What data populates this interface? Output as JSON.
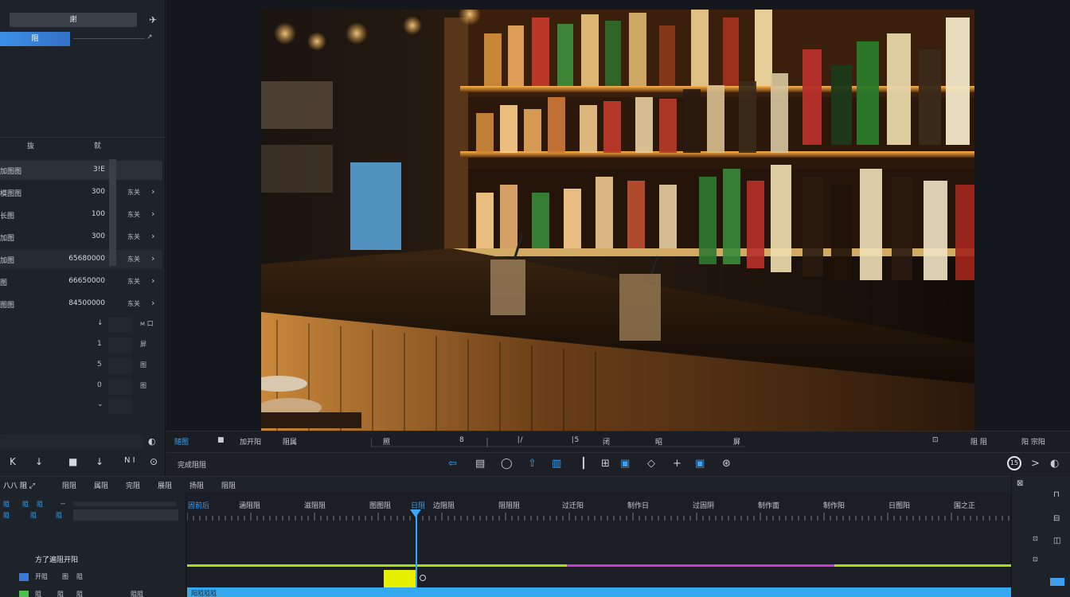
{
  "left_panel": {
    "top_field": "謝",
    "top_icon": "✈",
    "active_tab": "阻",
    "tab_end": "↗",
    "props_header": [
      "抜",
      "就"
    ],
    "properties": [
      {
        "label": "加图图",
        "value": "3!E",
        "action": "",
        "hl": true
      },
      {
        "label": "模图图",
        "value": "300",
        "action": "东关",
        "hl": false
      },
      {
        "label": "长图",
        "value": "100",
        "action": "东关",
        "hl": false
      },
      {
        "label": "加图",
        "value": "300",
        "action": "东关",
        "hl": false
      },
      {
        "label": "加图",
        "value": "65680000",
        "action": "东关",
        "hl": true
      },
      {
        "label": "图",
        "value": "66650000",
        "action": "东关",
        "hl": false
      },
      {
        "label": "图图",
        "value": "84500000",
        "action": "东关",
        "hl": false
      }
    ],
    "controls": [
      {
        "k": "↓",
        "v": "ᴍ 口"
      },
      {
        "k": "1",
        "v": "屏"
      },
      {
        "k": "5",
        "v": "图"
      },
      {
        "k": "0",
        "v": "图"
      },
      {
        "k": "⌄",
        "v": ""
      }
    ],
    "bottom_icon": "◐",
    "tools": [
      "K",
      "↓",
      "■",
      "↓",
      "N I",
      "⊙"
    ]
  },
  "preview_toolbar": {
    "items": [
      "随图",
      "■",
      "加开阳",
      "阻属",
      "照",
      "8",
      "∣∕",
      "∣5",
      "闭",
      "昭",
      "屏"
    ],
    "right_items": [
      "⊡",
      "阻 阻",
      "阳 宗阳"
    ]
  },
  "transport": {
    "label": "完成阻阻",
    "icons": [
      "⇦",
      "▤",
      "◯",
      "⇧",
      "▥",
      "┃",
      "⊞",
      "▣",
      "◇",
      "+",
      "▣",
      "⊛"
    ],
    "circle_label": "15",
    "right_icons": [
      ">",
      "◐"
    ]
  },
  "timeline": {
    "tabs": [
      "八八 阻 ⤢",
      "阻阻",
      "属阻",
      "完阻",
      "展阻",
      "扬阻",
      "阻阻"
    ],
    "ruler_labels": [
      "固前后",
      "涵阻阻",
      "滋阻阻",
      "图图阻",
      "日阻",
      "边阻阻",
      "阻阻阻",
      "过迁阳",
      "制作日",
      "过固阴",
      "制作面",
      "制作阳",
      "日图阳",
      "国之正"
    ],
    "left_labels": {
      "row1": [
        "阻",
        "阻",
        "阻",
        "--"
      ],
      "row2": [
        "阻",
        "阻",
        "阻"
      ],
      "name": "方了遍阻开阳",
      "track1": [
        "开阻",
        "图",
        "阻"
      ],
      "track2": [
        "阻",
        "阻",
        "阻",
        "阻阻"
      ]
    },
    "blue_bar_label": "阳阻阻阻",
    "right_col": [
      "⊠",
      "⊓",
      "⊟",
      "◫",
      "⊡",
      "⊡",
      "⊙"
    ]
  },
  "colors": {
    "accent": "#37a6ff",
    "track_green": "#a6e00c",
    "track_magenta": "#d438d4",
    "clip_yellow": "#e7f000"
  }
}
